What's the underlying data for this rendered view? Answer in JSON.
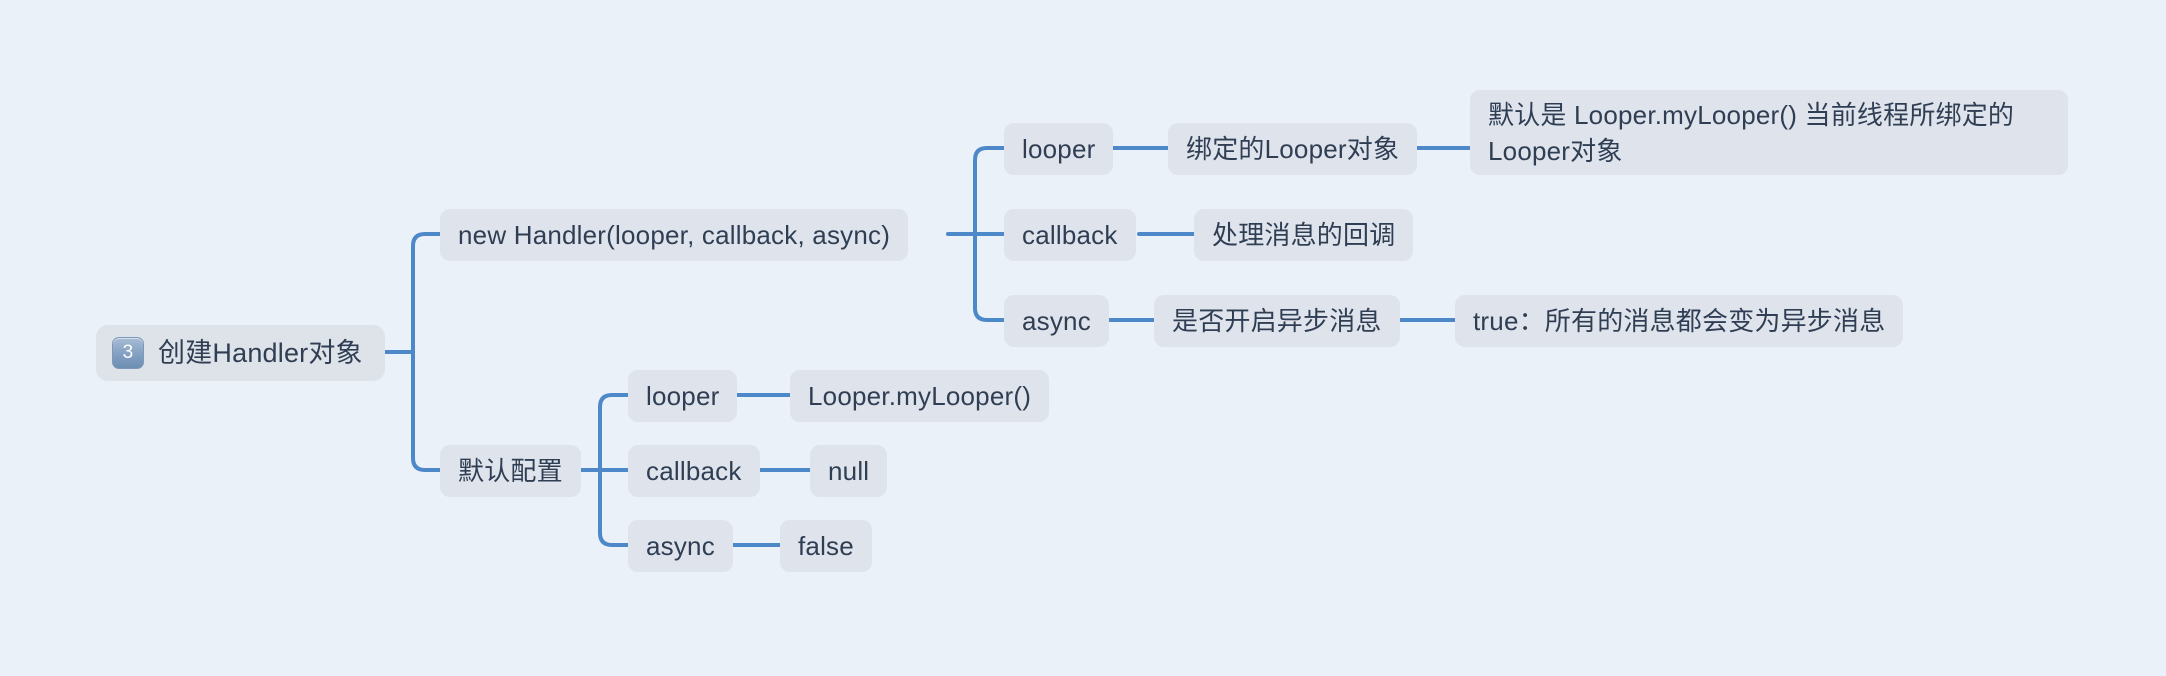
{
  "canvas": {
    "background_color": "#eaf1f9",
    "node_background_color": "#dfe4ec",
    "node_text_color": "#303e54",
    "connector_color": "#4d88c8",
    "badge_color": "#86a3c4"
  },
  "mindmap": {
    "root": {
      "badge": "3",
      "label": "创建Handler对象"
    },
    "branches": [
      {
        "label": "new Handler(looper, callback, async)",
        "children": [
          {
            "label": "looper",
            "children": [
              {
                "label": "绑定的Looper对象",
                "children": [
                  {
                    "label": "默认是 Looper.myLooper() 当前线程所绑定的Looper对象",
                    "children": []
                  }
                ]
              }
            ]
          },
          {
            "label": "callback",
            "children": [
              {
                "label": "处理消息的回调",
                "children": []
              }
            ]
          },
          {
            "label": "async",
            "children": [
              {
                "label": "是否开启异步消息",
                "children": [
                  {
                    "label": "true：所有的消息都会变为异步消息",
                    "children": []
                  }
                ]
              }
            ]
          }
        ]
      },
      {
        "label": "默认配置",
        "children": [
          {
            "label": "looper",
            "children": [
              {
                "label": "Looper.myLooper()",
                "children": []
              }
            ]
          },
          {
            "label": "callback",
            "children": [
              {
                "label": "null",
                "children": []
              }
            ]
          },
          {
            "label": "async",
            "children": [
              {
                "label": "false",
                "children": []
              }
            ]
          }
        ]
      }
    ]
  }
}
